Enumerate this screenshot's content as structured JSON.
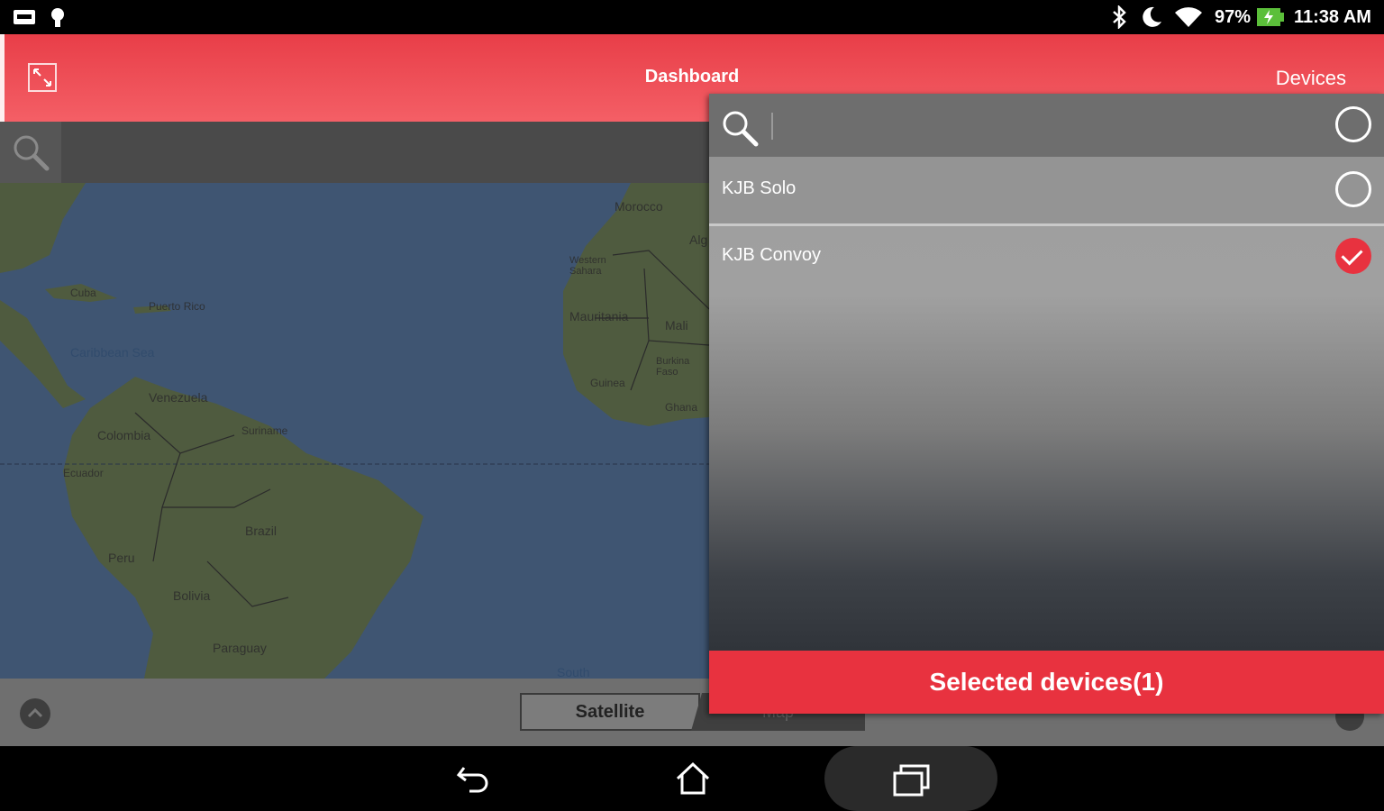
{
  "status_bar": {
    "battery_percent": "97%",
    "time": "11:38 AM",
    "icons": [
      "screenshot-icon",
      "lightbulb-icon",
      "bluetooth-icon",
      "moon-icon",
      "wifi-icon",
      "battery-charging-icon"
    ]
  },
  "app_bar": {
    "title": "Dashboard",
    "devices_tab": "Devices",
    "fullscreen_icon": "fullscreen-icon"
  },
  "map": {
    "labels": {
      "morocco": "Morocco",
      "algeria": "Alg",
      "western_sahara": "Western Sahara",
      "mauritania": "Mauritania",
      "mali": "Mali",
      "burkina_faso": "Burkina Faso",
      "guinea": "Guinea",
      "ghana": "Ghana",
      "cuba": "Cuba",
      "puerto_rico": "Puerto Rico",
      "caribbean_sea": "Caribbean Sea",
      "venezuela": "Venezuela",
      "colombia": "Colombia",
      "suriname": "Suriname",
      "ecuador": "Ecuador",
      "brazil": "Brazil",
      "peru": "Peru",
      "bolivia": "Bolivia",
      "paraguay": "Paraguay",
      "south": "South"
    },
    "type_toggle": {
      "satellite": "Satellite",
      "map": "Map"
    }
  },
  "device_panel": {
    "search_placeholder": "",
    "devices": [
      {
        "name": "KJB Solo",
        "selected": false
      },
      {
        "name": "KJB Convoy",
        "selected": true
      }
    ],
    "selected_button": "Selected devices(1)"
  },
  "colors": {
    "accent": "#e8323f",
    "ocean": "#3f5572",
    "land": "#4f5b3f"
  }
}
